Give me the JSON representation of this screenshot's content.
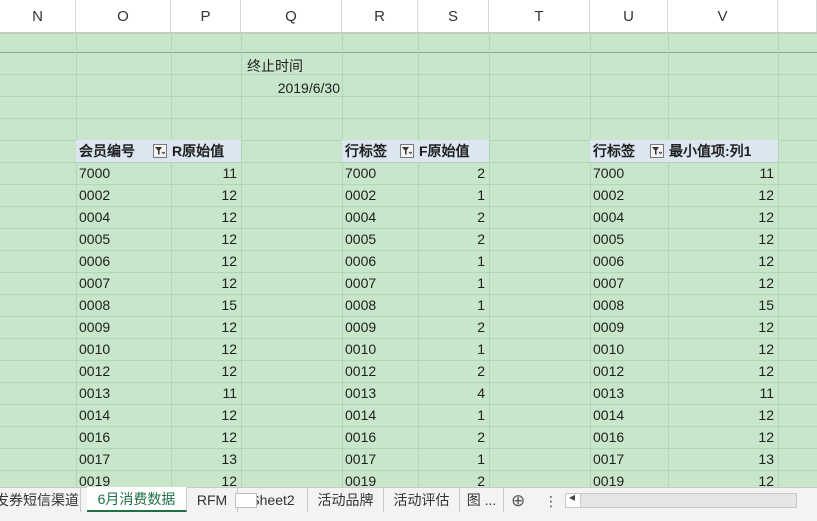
{
  "columns": [
    "N",
    "O",
    "P",
    "Q",
    "R",
    "S",
    "T",
    "U",
    "V"
  ],
  "end_time": {
    "label": "终止时间",
    "value": "2019/6/30"
  },
  "pivot_r": {
    "headers": [
      "会员编号",
      "R原始值"
    ],
    "rows": [
      [
        "7000",
        "11"
      ],
      [
        "0002",
        "12"
      ],
      [
        "0004",
        "12"
      ],
      [
        "0005",
        "12"
      ],
      [
        "0006",
        "12"
      ],
      [
        "0007",
        "12"
      ],
      [
        "0008",
        "15"
      ],
      [
        "0009",
        "12"
      ],
      [
        "0010",
        "12"
      ],
      [
        "0012",
        "12"
      ],
      [
        "0013",
        "11"
      ],
      [
        "0014",
        "12"
      ],
      [
        "0016",
        "12"
      ],
      [
        "0017",
        "13"
      ],
      [
        "0019",
        "12"
      ]
    ]
  },
  "pivot_f": {
    "headers": [
      "行标签",
      "F原始值"
    ],
    "rows": [
      [
        "7000",
        "2"
      ],
      [
        "0002",
        "1"
      ],
      [
        "0004",
        "2"
      ],
      [
        "0005",
        "2"
      ],
      [
        "0006",
        "1"
      ],
      [
        "0007",
        "1"
      ],
      [
        "0008",
        "1"
      ],
      [
        "0009",
        "2"
      ],
      [
        "0010",
        "1"
      ],
      [
        "0012",
        "2"
      ],
      [
        "0013",
        "4"
      ],
      [
        "0014",
        "1"
      ],
      [
        "0016",
        "2"
      ],
      [
        "0017",
        "1"
      ],
      [
        "0019",
        "2"
      ]
    ]
  },
  "pivot_min": {
    "headers": [
      "行标签",
      "最小值项:列1"
    ],
    "rows": [
      [
        "7000",
        "11"
      ],
      [
        "0002",
        "12"
      ],
      [
        "0004",
        "12"
      ],
      [
        "0005",
        "12"
      ],
      [
        "0006",
        "12"
      ],
      [
        "0007",
        "12"
      ],
      [
        "0008",
        "15"
      ],
      [
        "0009",
        "12"
      ],
      [
        "0010",
        "12"
      ],
      [
        "0012",
        "12"
      ],
      [
        "0013",
        "11"
      ],
      [
        "0014",
        "12"
      ],
      [
        "0016",
        "12"
      ],
      [
        "0017",
        "13"
      ],
      [
        "0019",
        "12"
      ]
    ]
  },
  "sheet_tabs": [
    "发券短信渠道",
    "6月消费数据",
    "RFM",
    "Sheet2",
    "活动品牌",
    "活动评估",
    "图 ..."
  ],
  "active_tab_index": 1,
  "tools": {
    "add_sheet": "⊕",
    "more": "⋮",
    "scroll_left": "◂"
  },
  "colors": {
    "grid": "#c8e6c9",
    "pivot_header": "#dce6f0",
    "active_tab": "#1e7145"
  }
}
